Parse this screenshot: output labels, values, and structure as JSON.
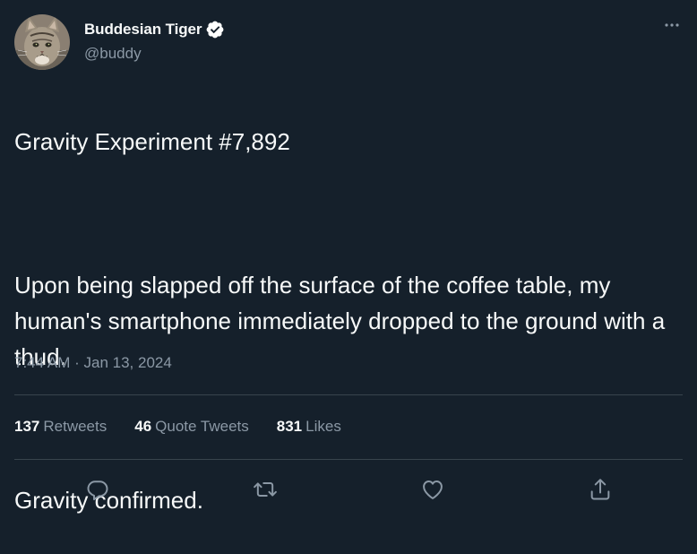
{
  "author": {
    "display_name": "Buddesian Tiger",
    "handle": "@buddy",
    "verified": true
  },
  "tweet": {
    "paragraphs": [
      "Gravity Experiment #7,892",
      "Upon being slapped off the surface of the coffee table, my human's smartphone immediately dropped to the ground with a thud.",
      "Gravity confirmed."
    ],
    "time": "7:44 AM",
    "separator": "·",
    "date": "Jan 13, 2024"
  },
  "stats": [
    {
      "count": "137",
      "label": "Retweets"
    },
    {
      "count": "46",
      "label": "Quote Tweets"
    },
    {
      "count": "831",
      "label": "Likes"
    }
  ],
  "actions": [
    {
      "icon": "reply-icon"
    },
    {
      "icon": "retweet-icon"
    },
    {
      "icon": "like-icon"
    },
    {
      "icon": "share-icon"
    }
  ],
  "colors": {
    "background": "#15202b",
    "text_primary": "#f7f9f9",
    "text_secondary": "#8b98a5",
    "divider": "#38444d",
    "verified_badge": "#ffffff"
  }
}
